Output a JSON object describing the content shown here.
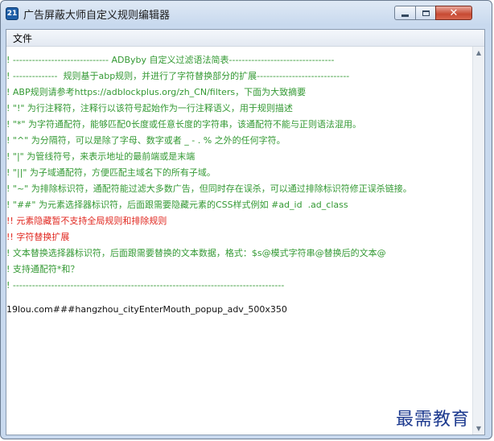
{
  "window": {
    "title": "广告屏蔽大师自定义规则编辑器",
    "icon_label": "21",
    "controls": [
      "minimize-icon",
      "maximize-icon",
      "close-icon"
    ],
    "close_glyph": "✕"
  },
  "menu": {
    "file_label": "文件"
  },
  "editor": {
    "lines": [
      {
        "text": "! ------------------------------ ADByby 自定义过滤语法简表---------------------------------",
        "color": "#339933"
      },
      {
        "text": "! --------------  规则基于abp规则，并进行了字符替换部分的扩展-----------------------------",
        "color": "#339933"
      },
      {
        "text": "! ABP规则请参考https://adblockplus.org/zh_CN/filters，下面为大致摘要",
        "color": "#339933"
      },
      {
        "text": "! \"!\" 为行注释符，注释行以该符号起始作为一行注释语义，用于规则描述",
        "color": "#339933"
      },
      {
        "text": "! \"*\" 为字符通配符，能够匹配0长度或任意长度的字符串，该通配符不能与正则语法混用。",
        "color": "#339933"
      },
      {
        "text": "! \"^\" 为分隔符，可以是除了字母、数字或者 _ - . % 之外的任何字符。",
        "color": "#339933"
      },
      {
        "text": "! \"|\" 为管线符号，来表示地址的最前端或是末端",
        "color": "#339933"
      },
      {
        "text": "! \"||\" 为子域通配符，方便匹配主域名下的所有子域。",
        "color": "#339933"
      },
      {
        "text": "! \"~\" 为排除标识符，通配符能过滤大多数广告，但同时存在误杀，可以通过排除标识符修正误杀链接。",
        "color": "#339933"
      },
      {
        "text": "! \"##\" 为元素选择器标识符，后面跟需要隐藏元素的CSS样式例如 #ad_id  .ad_class",
        "color": "#339933"
      },
      {
        "text": "!! 元素隐藏暂不支持全局规则和排除规则",
        "color": "#e0261e"
      },
      {
        "text": "!! 字符替换扩展",
        "color": "#e0261e"
      },
      {
        "text": "! 文本替换选择器标识符，后面跟需要替换的文本数据，格式：$s@模式字符串@替换后的文本@",
        "color": "#339933"
      },
      {
        "text": "! 支持通配符*和？",
        "color": "#339933"
      },
      {
        "text": "! -------------------------------------------------------------------------------------",
        "color": "#339933"
      },
      {
        "text": "",
        "color": "#111111"
      },
      {
        "text": "19lou.com###hangzhou_cityEnterMouth_popup_adv_500x350",
        "color": "#111111"
      }
    ]
  },
  "scrollbar": {
    "up_glyph": "▲",
    "down_glyph": "▼"
  },
  "watermark": {
    "text": "最需教育",
    "color": "#1d3a8f"
  }
}
